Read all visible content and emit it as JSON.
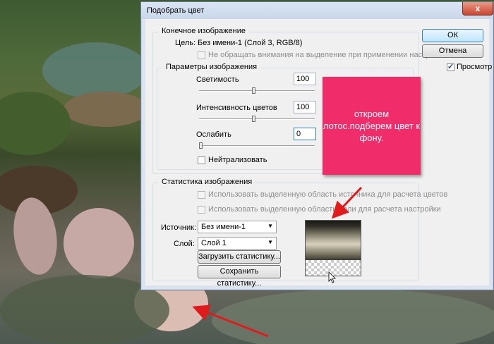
{
  "dialog": {
    "title": "Подобрать цвет",
    "close": "x",
    "ok": "ОК",
    "cancel": "Отмена",
    "preview_label": "Просмотр",
    "preview_checked": true
  },
  "target": {
    "group_label": "Конечное изображение",
    "target_label": "Цель:",
    "target_value": "Без имени-1 (Слой 3, RGB/8)",
    "ignore_selection": "Не обращать внимания на выделение при применении настроек"
  },
  "options": {
    "group_label": "Параметры изображения",
    "luminance_label": "Светимость",
    "luminance_value": "100",
    "intensity_label": "Интенсивность цветов",
    "intensity_value": "100",
    "fade_label": "Ослабить",
    "fade_value": "0",
    "neutralize_label": "Нейтрализовать"
  },
  "stats": {
    "group_label": "Статистика изображения",
    "use_source_selection": "Использовать выделенную область источника для расчета цветов",
    "use_target_selection": "Использовать выделенную область цели для расчета настройки",
    "source_label": "Источник:",
    "source_value": "Без имени-1",
    "layer_label": "Слой:",
    "layer_value": "Слой 1",
    "load_button": "Загрузить статистику...",
    "save_button": "Сохранить статистику..."
  },
  "annotation": {
    "text": "откроем лотос.подберем цвет к фону.",
    "color": "#f02d6a",
    "arrow_color": "#e01b1b"
  }
}
